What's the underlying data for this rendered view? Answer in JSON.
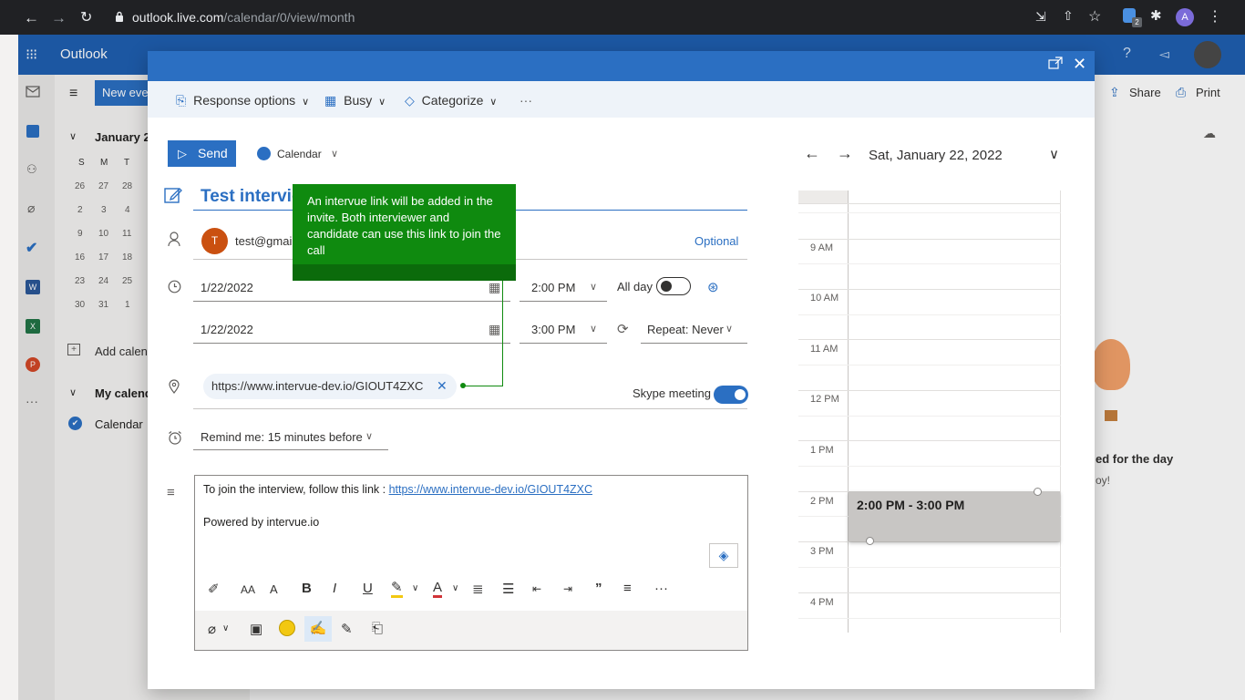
{
  "browser": {
    "url_host": "outlook.live.com",
    "url_path": "/calendar/0/view/month",
    "profile_initial": "A",
    "ext_badge": "2"
  },
  "outlook": {
    "app_name": "Outlook",
    "new_event": "New eve",
    "month_label": "January 2",
    "weekday_headers": [
      "S",
      "M",
      "T"
    ],
    "mini_calendar": [
      [
        "26",
        "27",
        "28"
      ],
      [
        "2",
        "3",
        "4"
      ],
      [
        "9",
        "10",
        "11"
      ],
      [
        "16",
        "17",
        "18"
      ],
      [
        "23",
        "24",
        "25"
      ],
      [
        "30",
        "31",
        "1"
      ]
    ],
    "add_calendar": "Add calen",
    "my_calendars": "My calend",
    "calendar_item": "Calendar",
    "share": "Share",
    "print": "Print",
    "empty_title": "ed for the day",
    "empty_sub": "oy!"
  },
  "modal": {
    "toolbar": {
      "response_options": "Response options",
      "busy": "Busy",
      "categorize": "Categorize",
      "more": "···"
    },
    "send": "Send",
    "calendar": "Calendar",
    "title": "Test intervie",
    "attendee_initial": "T",
    "attendee_email": "test@gmai",
    "optional": "Optional",
    "start_date": "1/22/2022",
    "start_time": "2:00 PM",
    "all_day": "All day",
    "end_date": "1/22/2022",
    "end_time": "3:00 PM",
    "repeat": "Repeat: Never",
    "location": "https://www.intervue-dev.io/GIOUT4ZXC",
    "skype_meeting": "Skype meeting",
    "reminder": "Remind me: 15 minutes before",
    "body_line1_text": "To join the interview, follow this link : ",
    "body_line1_link": "https://www.intervue-dev.io/GIOUT4ZXC",
    "body_line2": "Powered by intervue.io"
  },
  "tooltip": {
    "text": "An intervue link will be added in the invite. Both interviewer and candidate can use this link to join the call"
  },
  "day_view": {
    "date_label": "Sat, January 22, 2022",
    "hours": [
      "9 AM",
      "10 AM",
      "11 AM",
      "12 PM",
      "1 PM",
      "2 PM",
      "3 PM",
      "4 PM"
    ],
    "event": "2:00 PM - 3:00 PM"
  },
  "colors": {
    "brand_blue": "#2b6fc2",
    "tooltip_green": "#0f8a0f",
    "event_gray": "#c8c6c4"
  }
}
